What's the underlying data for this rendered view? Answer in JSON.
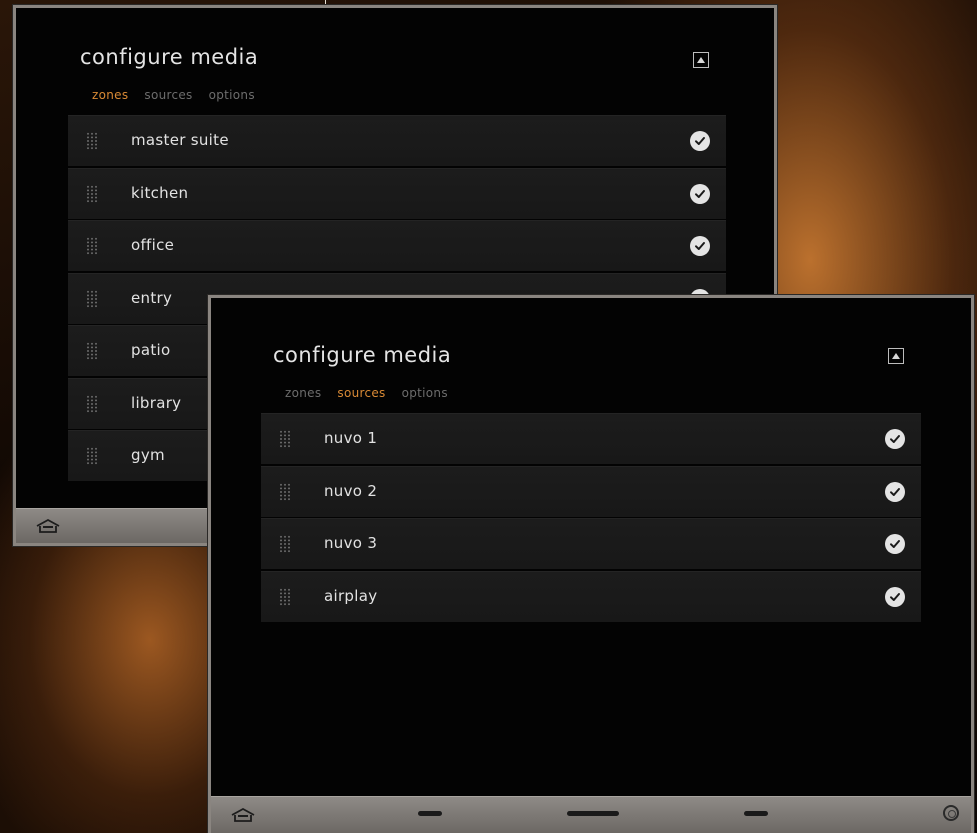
{
  "back_screen": {
    "title": "configure media",
    "tabs": [
      {
        "label": "zones",
        "active": true
      },
      {
        "label": "sources",
        "active": false
      },
      {
        "label": "options",
        "active": false
      }
    ],
    "items": [
      {
        "label": "master suite",
        "checked": true
      },
      {
        "label": "kitchen",
        "checked": true
      },
      {
        "label": "office",
        "checked": true
      },
      {
        "label": "entry",
        "checked": true
      },
      {
        "label": "patio",
        "checked": true
      },
      {
        "label": "library",
        "checked": true
      },
      {
        "label": "gym",
        "checked": true
      }
    ],
    "bottom_bar": {
      "icons": [
        "home-icon"
      ]
    }
  },
  "front_screen": {
    "title": "configure media",
    "tabs": [
      {
        "label": "zones",
        "active": false
      },
      {
        "label": "sources",
        "active": true
      },
      {
        "label": "options",
        "active": false
      }
    ],
    "items": [
      {
        "label": "nuvo 1",
        "checked": true
      },
      {
        "label": "nuvo 2",
        "checked": true
      },
      {
        "label": "nuvo 3",
        "checked": true
      },
      {
        "label": "airplay",
        "checked": true
      }
    ],
    "bottom_bar": {
      "icons": [
        "home-icon",
        "page-indicator",
        "page-indicator-active",
        "page-indicator",
        "ring-icon"
      ]
    }
  },
  "colors": {
    "accent_active_tab": "#d98a35",
    "callout_marker": "#e0a43c",
    "panel_border": "#8a8580"
  }
}
